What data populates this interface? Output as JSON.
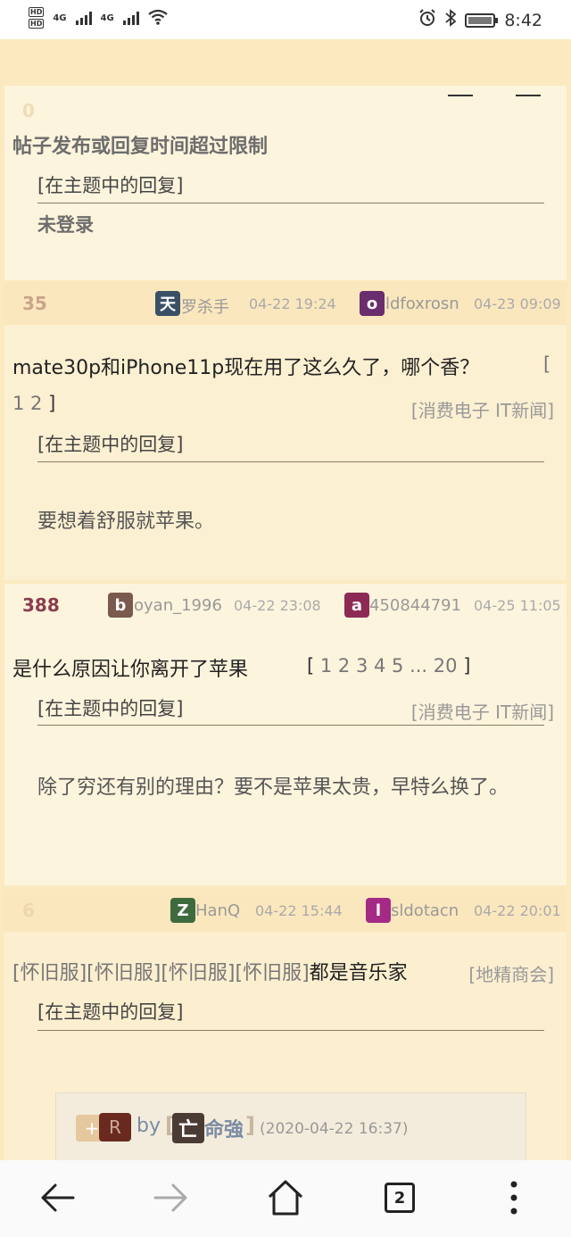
{
  "status_bar": {
    "time": "8:42",
    "net1": "4G",
    "net2": "4G",
    "hd1": "HD",
    "hd2": "HD"
  },
  "post0": {
    "count": "0",
    "title": "帖子发布或回复时间超过限制",
    "sub_label": "[在主题中的回复]",
    "excerpt": "未登录"
  },
  "topics": [
    {
      "count": "35",
      "count_color": "#c9a58a",
      "author_initial": "天",
      "author_color": "#3a5165",
      "author": "罗杀手",
      "created": "04-22 19:24",
      "last_initial": "o",
      "last_color": "#6a2d6d",
      "last": "ldfoxrosn",
      "last_time": "04-23 09:09",
      "title": "mate30p和iPhone11p现在用了这么久了，哪个香？",
      "pages_open": "[",
      "pages_nums": "1 2",
      "pages_close": "]",
      "forum": "[消费电子 IT新闻]",
      "sub_label": "[在主题中的回复]",
      "excerpt": "要想着舒服就苹果。"
    },
    {
      "count": "388",
      "count_color": "#8a3c4d",
      "author_initial": "b",
      "author_color": "#7a5a4e",
      "author": "oyan_1996",
      "created": "04-22 23:08",
      "last_initial": "a",
      "last_color": "#8c2a55",
      "last": "450844791",
      "last_time": "04-25 11:05",
      "title": "是什么原因让你离开了苹果",
      "pages_open": "[",
      "pages_nums": "1 2 3 4 5 ... 20",
      "pages_close": "]",
      "forum": "[消费电子 IT新闻]",
      "sub_label": "[在主题中的回复]",
      "excerpt": "除了穷还有别的理由？要不是苹果太贵，早特么换了。"
    },
    {
      "count": "6",
      "count_color": "#ecd7b3",
      "author_initial": "Z",
      "author_color": "#3e6b3e",
      "author": "HanQ",
      "created": "04-22 15:44",
      "last_initial": "l",
      "last_color": "#a52a85",
      "last": "sldotacn",
      "last_time": "04-22 20:01",
      "title_tags": "[怀旧服][怀旧服][怀旧服][怀旧服]",
      "title_main": "都是音乐家",
      "forum": "[地精商会]",
      "sub_label": "[在主题中的回复]"
    }
  ],
  "reply_box": {
    "plus": "+",
    "r_badge": "R",
    "by": "by",
    "user_open": "[",
    "user_initial": "亡",
    "user": "命強",
    "user_close": "]",
    "date": "(2020-04-22 16:37)"
  },
  "nav": {
    "tab_count": "2"
  }
}
